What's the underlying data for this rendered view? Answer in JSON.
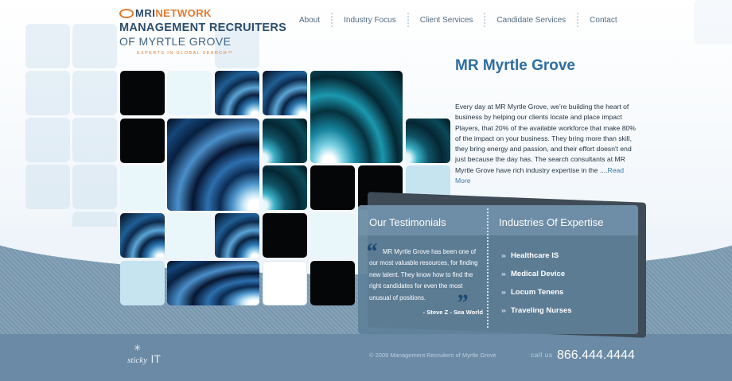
{
  "logo": {
    "brand_mri": "MRI",
    "brand_network": "NETWORK",
    "line1": "MANAGEMENT RECRUITERS",
    "line2": "OF MYRTLE GROVE",
    "tagline": "EXPERTS IN GLOBAL SEARCH™"
  },
  "nav": {
    "items": [
      "About",
      "Industry Focus",
      "Client Services",
      "Candidate Services",
      "Contact"
    ]
  },
  "main": {
    "title": "MR Myrtle Grove",
    "body": "Every day at MR Myrtle Grove, we’re building the heart of business by helping our clients locate and place impact Players, that 20% of the available workforce that make 80% of the impact on your business. They bring more than skill, they bring energy and passion, and their effort doesn't end just because the day has. The search consultants at MR Myrtle Grove have rich industry expertise in the ....",
    "read_more": "Read More"
  },
  "testimonials": {
    "heading": "Our Testimonials",
    "open_quote": "“",
    "close_quote": "”",
    "quote": "MR Myrtle Grove has been one of our most valuable resources, for finding new talent. They know how to find the right candidates for even the most unusual of positions.",
    "author": "- Steve Z - Sea World"
  },
  "industries": {
    "heading": "Industries Of Expertise",
    "chevron": "›››",
    "items": [
      "Healthcare IS",
      "Medical Device",
      "Locum Tenens",
      "Traveling Nurses"
    ]
  },
  "footer": {
    "credit_sticky": "sticky",
    "credit_it": "IT",
    "copyright": "© 2009 Management Recruiters of Myrtle Grove",
    "call_label": "call us",
    "phone": "866.444.4444"
  },
  "colors": {
    "accent_orange": "#e07a2e",
    "navy": "#2c4d6b",
    "title_blue": "#2e6ea0",
    "panel": "#5f8099",
    "footer": "#6a8aa5"
  },
  "icons": [
    "mri-logo-mark-icon",
    "open-quote-icon",
    "close-quote-icon",
    "chevron-triple-icon",
    "sticky-it-logo-icon"
  ]
}
